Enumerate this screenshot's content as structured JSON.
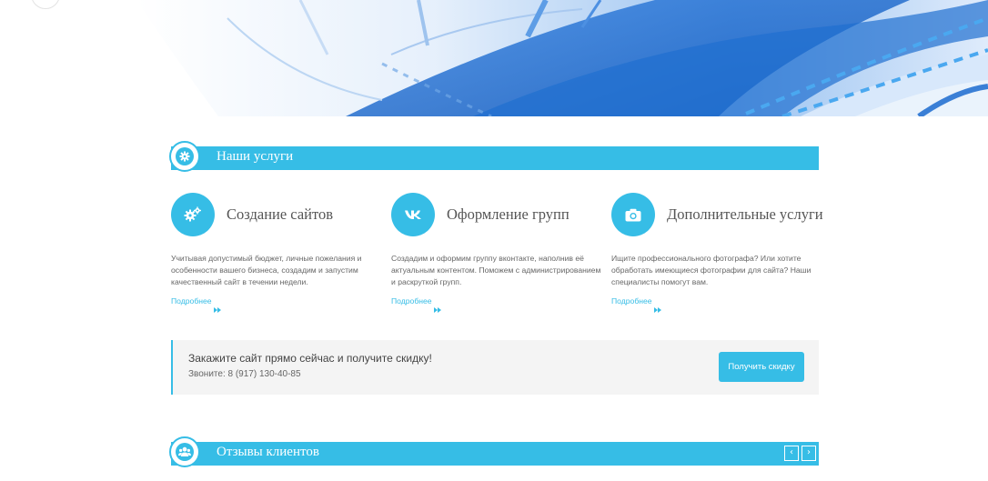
{
  "services_section": {
    "title": "Наши услуги",
    "items": [
      {
        "heading": "Создание сайтов",
        "icon": "gears-icon",
        "description": "Учитывая допустимый бюджет, личные пожелания и особенности вашего бизнеса, создадим и запустим качественный сайт в течении недели.",
        "more_label": "Подробнее"
      },
      {
        "heading": "Оформление групп",
        "icon": "vk-icon",
        "description": "Создадим и оформим группу вконтакте, наполнив её актуальным контентом. Поможем с администрированием и раскруткой групп.",
        "more_label": "Подробнее"
      },
      {
        "heading": "Дополнительные услуги",
        "icon": "camera-icon",
        "description": "Ищите профессионального фотографа? Или хотите обработать имеющиеся фотографии для сайта? Наши специалисты помогут вам.",
        "more_label": "Подробнее"
      }
    ]
  },
  "cta": {
    "headline": "Закажите сайт прямо сейчас и получите скидку!",
    "phone": "Звоните: 8 (917) 130-40-85",
    "button_label": "Получить скидку"
  },
  "reviews_section": {
    "title": "Отзывы клиентов",
    "prev_label": "‹",
    "next_label": "›"
  },
  "colors": {
    "accent": "#36bde6",
    "cta_background": "#f4f4f4"
  }
}
